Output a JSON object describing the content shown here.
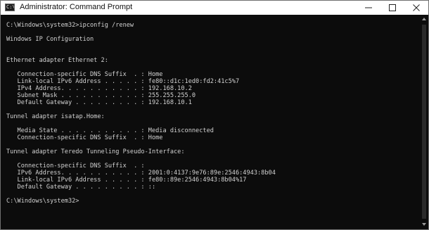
{
  "window": {
    "title": "Administrator: Command Prompt",
    "icon": "command-prompt-icon",
    "icon_glyph": "C:\\",
    "controls": [
      "minimize-icon",
      "maximize-icon",
      "close-icon"
    ]
  },
  "console": {
    "lines": [
      "C:\\Windows\\system32>ipconfig /renew",
      "Windows IP Configuration",
      "Ethernet adapter Ethernet 2:",
      "   Connection-specific DNS Suffix  . : Home",
      "   Link-local IPv6 Address . . . . . : fe80::d1c:1ed0:fd2:41c5%7",
      "   IPv4 Address. . . . . . . . . . . : 192.168.10.2",
      "   Subnet Mask . . . . . . . . . . . : 255.255.255.0",
      "   Default Gateway . . . . . . . . . : 192.168.10.1",
      "Tunnel adapter isatap.Home:",
      "   Media State . . . . . . . . . . . : Media disconnected",
      "   Connection-specific DNS Suffix  . : Home",
      "Tunnel adapter Teredo Tunneling Pseudo-Interface:",
      "   Connection-specific DNS Suffix  . :",
      "   IPv6 Address. . . . . . . . . . . : 2001:0:4137:9e76:89e:2546:4943:8b04",
      "   Link-local IPv6 Address . . . . . : fe80::89e:2546:4943:8b04%17",
      "   Default Gateway . . . . . . . . . : ::",
      "C:\\Windows\\system32>"
    ]
  },
  "colors": {
    "console_background": "#0c0c0c",
    "console_text": "#d2d2d2",
    "titlebar_background": "#ffffff"
  }
}
